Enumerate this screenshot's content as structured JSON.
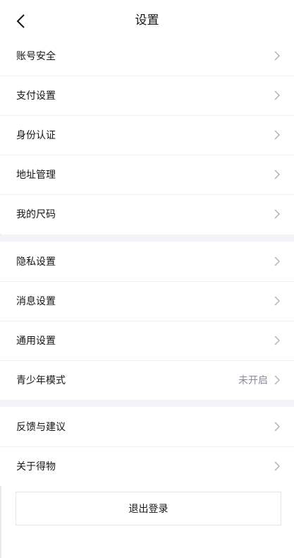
{
  "header": {
    "title": "设置",
    "back_icon": "chevron-left-icon"
  },
  "groups": [
    {
      "items": [
        {
          "label": "账号安全"
        },
        {
          "label": "支付设置"
        },
        {
          "label": "身份认证"
        },
        {
          "label": "地址管理"
        },
        {
          "label": "我的尺码"
        }
      ]
    },
    {
      "items": [
        {
          "label": "隐私设置"
        },
        {
          "label": "消息设置"
        },
        {
          "label": "通用设置"
        },
        {
          "label": "青少年模式",
          "value": "未开启"
        }
      ]
    },
    {
      "items": [
        {
          "label": "反馈与建议"
        },
        {
          "label": "关于得物"
        }
      ]
    }
  ],
  "logout": {
    "label": "退出登录"
  },
  "colors": {
    "text": "#16161a",
    "muted": "#8c8c99",
    "separator": "#f4f4f8",
    "chevron": "#aaaaaf"
  },
  "icons": {
    "row_chevron": "chevron-right-icon"
  }
}
